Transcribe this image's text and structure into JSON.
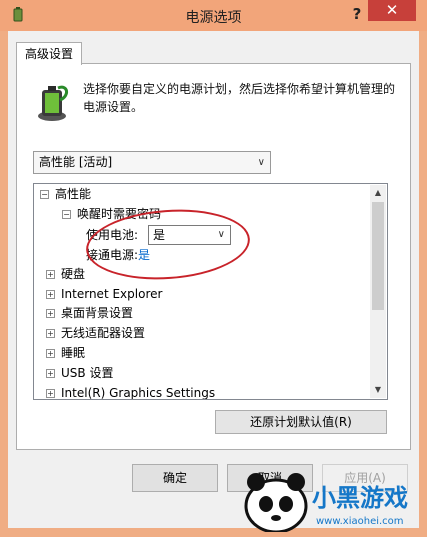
{
  "window": {
    "title": "电源选项",
    "help": "?",
    "close": "✕"
  },
  "tab": {
    "label": "高级设置"
  },
  "description": "选择你要自定义的电源计划，然后选择你希望计算机管理的电源设置。",
  "plan_select": {
    "value": "高性能 [活动]"
  },
  "tree": {
    "root": {
      "toggle": "⊟",
      "label": "高性能"
    },
    "child": {
      "toggle": "⊟",
      "label": "唤醒时需要密码"
    },
    "battery": {
      "label": "使用电池:",
      "value": "是"
    },
    "plugged": {
      "label": "接通电源:",
      "value": "是"
    },
    "items": [
      {
        "toggle": "⊞",
        "label": "硬盘"
      },
      {
        "toggle": "⊞",
        "label": "Internet Explorer"
      },
      {
        "toggle": "⊞",
        "label": "桌面背景设置"
      },
      {
        "toggle": "⊞",
        "label": "无线适配器设置"
      },
      {
        "toggle": "⊞",
        "label": "睡眠"
      },
      {
        "toggle": "⊞",
        "label": "USB 设置"
      },
      {
        "toggle": "⊞",
        "label": "Intel(R) Graphics Settings"
      }
    ]
  },
  "buttons": {
    "restore": "还原计划默认值(R)",
    "ok": "确定",
    "cancel": "取消",
    "apply": "应用(A)"
  },
  "watermark": {
    "brand": "小黑游戏",
    "url": "www.xiaohei.com"
  },
  "colors": {
    "title_bar": "#f2a57a",
    "close": "#c7403a",
    "annotation": "#c8232a",
    "link": "#0066cc"
  }
}
